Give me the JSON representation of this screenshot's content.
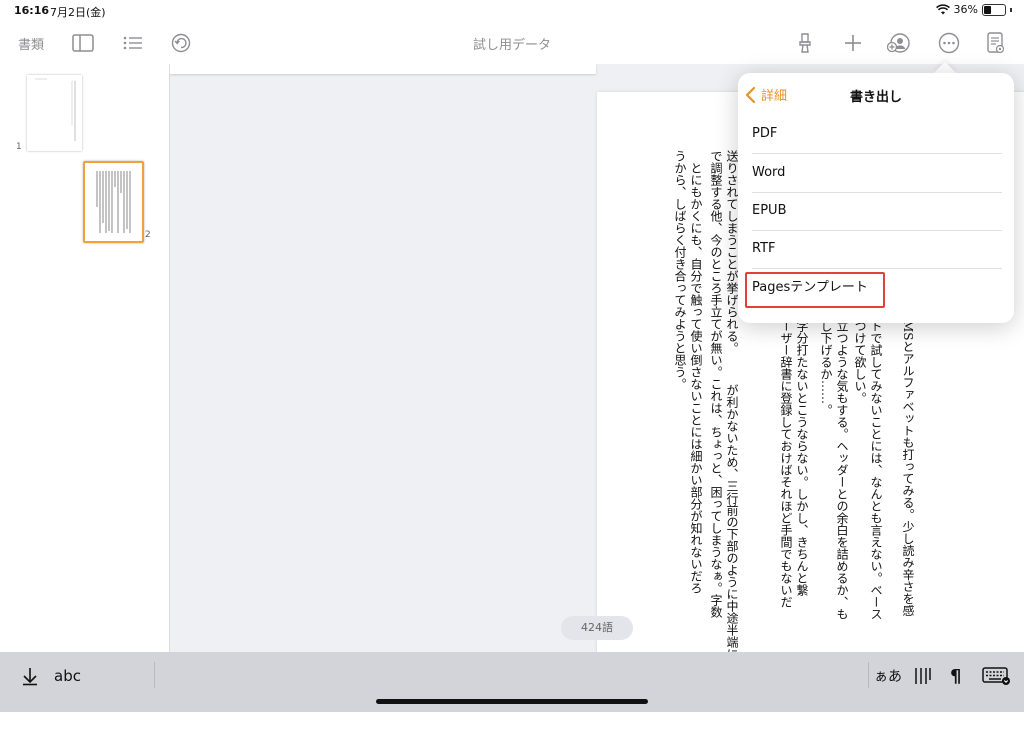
{
  "status": {
    "time": "16:16",
    "date": "7月2日(金)",
    "battery": "36%"
  },
  "toolbar": {
    "documents_label": "書類",
    "title": "試し用データ"
  },
  "thumbnails": [
    {
      "number": "1"
    },
    {
      "number": "2"
    }
  ],
  "document": {
    "right_columns": [
      "MSとアルファベットも打ってみる。少し読み辛さを感",
      "トで試してみないことには、なんとも言えない。ベース",
      "つけて欲しい。",
      "立つような気もする。ヘッダーとの余白を詰めるか、も",
      "し下げるか……。",
      "字分打たないとこうならない。しかし、きちんと繋",
      "ーザー辞書に登録しておけばそれほど手間でもないだ"
    ],
    "left_columns": [
      "送りされてしまうことが挙げられる。　　　が利かないため、三行前の下部のように中途半端に字",
      "で調整する他、今のところ手立てが無い。これは、ちょっと、困ってしまうなぁ。字数",
      "　とにもかくにも、自分で触って使い倒さないことには細かい部分が知れないだろ",
      "うから、しばらく付き合ってみようと思う。"
    ],
    "word_count": "424語"
  },
  "export_popover": {
    "back_label": "詳細",
    "title": "書き出し",
    "items": [
      "PDF",
      "Word",
      "EPUB",
      "RTF",
      "Pagesテンプレート"
    ]
  },
  "bottom_bar": {
    "abc_label": "abc",
    "kana_label": "ぁあ",
    "pilcrow": "¶"
  },
  "colors": {
    "accent": "#e8902a",
    "highlight": "#e0413a",
    "thumb_selected": "#f0a13c"
  }
}
